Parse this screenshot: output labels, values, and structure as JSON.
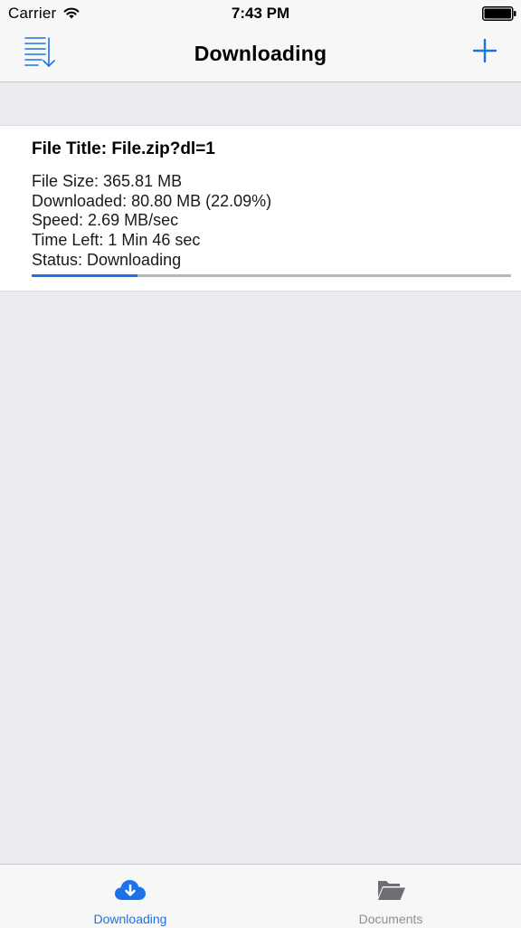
{
  "status_bar": {
    "carrier": "Carrier",
    "time": "7:43 PM"
  },
  "nav": {
    "title": "Downloading",
    "left_icon": "sort-list-icon",
    "right_icon": "plus-icon"
  },
  "download": {
    "title": "File Title: File.zip?dl=1",
    "file_size": "File Size: 365.81 MB",
    "downloaded": "Downloaded: 80.80 MB (22.09%)",
    "speed": "Speed: 2.69 MB/sec",
    "time_left": "Time Left: 1 Min 46 sec",
    "status": "Status: Downloading",
    "progress": 0.2209
  },
  "tabs": [
    {
      "label": "Downloading",
      "icon": "cloud-download-icon",
      "selected": true
    },
    {
      "label": "Documents",
      "icon": "folder-icon",
      "selected": false
    }
  ],
  "colors": {
    "accent": "#1a73e8",
    "inactive": "#8e8e93",
    "background": "#ebebf0"
  }
}
